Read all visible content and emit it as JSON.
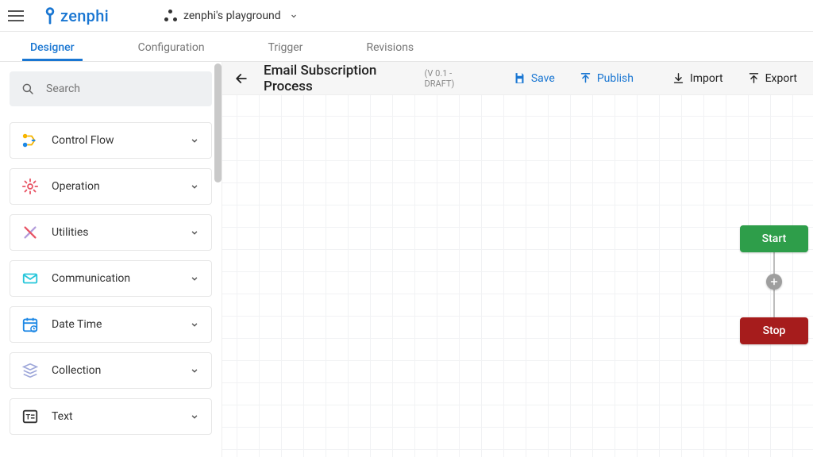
{
  "header": {
    "logo_text": "zenphi",
    "workspace": "zenphi's playground"
  },
  "tabs": [
    {
      "label": "Designer",
      "active": true
    },
    {
      "label": "Configuration",
      "active": false
    },
    {
      "label": "Trigger",
      "active": false
    },
    {
      "label": "Revisions",
      "active": false
    }
  ],
  "sidebar": {
    "search_placeholder": "Search",
    "categories": [
      {
        "label": "Control Flow",
        "icon": "flow",
        "color": "#f7b500"
      },
      {
        "label": "Operation",
        "icon": "gear",
        "color": "#e85465"
      },
      {
        "label": "Utilities",
        "icon": "tools",
        "color": "#b39ddb"
      },
      {
        "label": "Communication",
        "icon": "mail",
        "color": "#26c6da"
      },
      {
        "label": "Date Time",
        "icon": "calendar",
        "color": "#1e88e5"
      },
      {
        "label": "Collection",
        "icon": "layers",
        "color": "#9fa8da"
      },
      {
        "label": "Text",
        "icon": "text",
        "color": "#333333"
      }
    ]
  },
  "toolbar": {
    "title": "Email Subscription Process",
    "version": "(V 0.1 - DRAFT)",
    "save": "Save",
    "publish": "Publish",
    "import": "Import",
    "export": "Export"
  },
  "flow": {
    "start_label": "Start",
    "stop_label": "Stop"
  }
}
